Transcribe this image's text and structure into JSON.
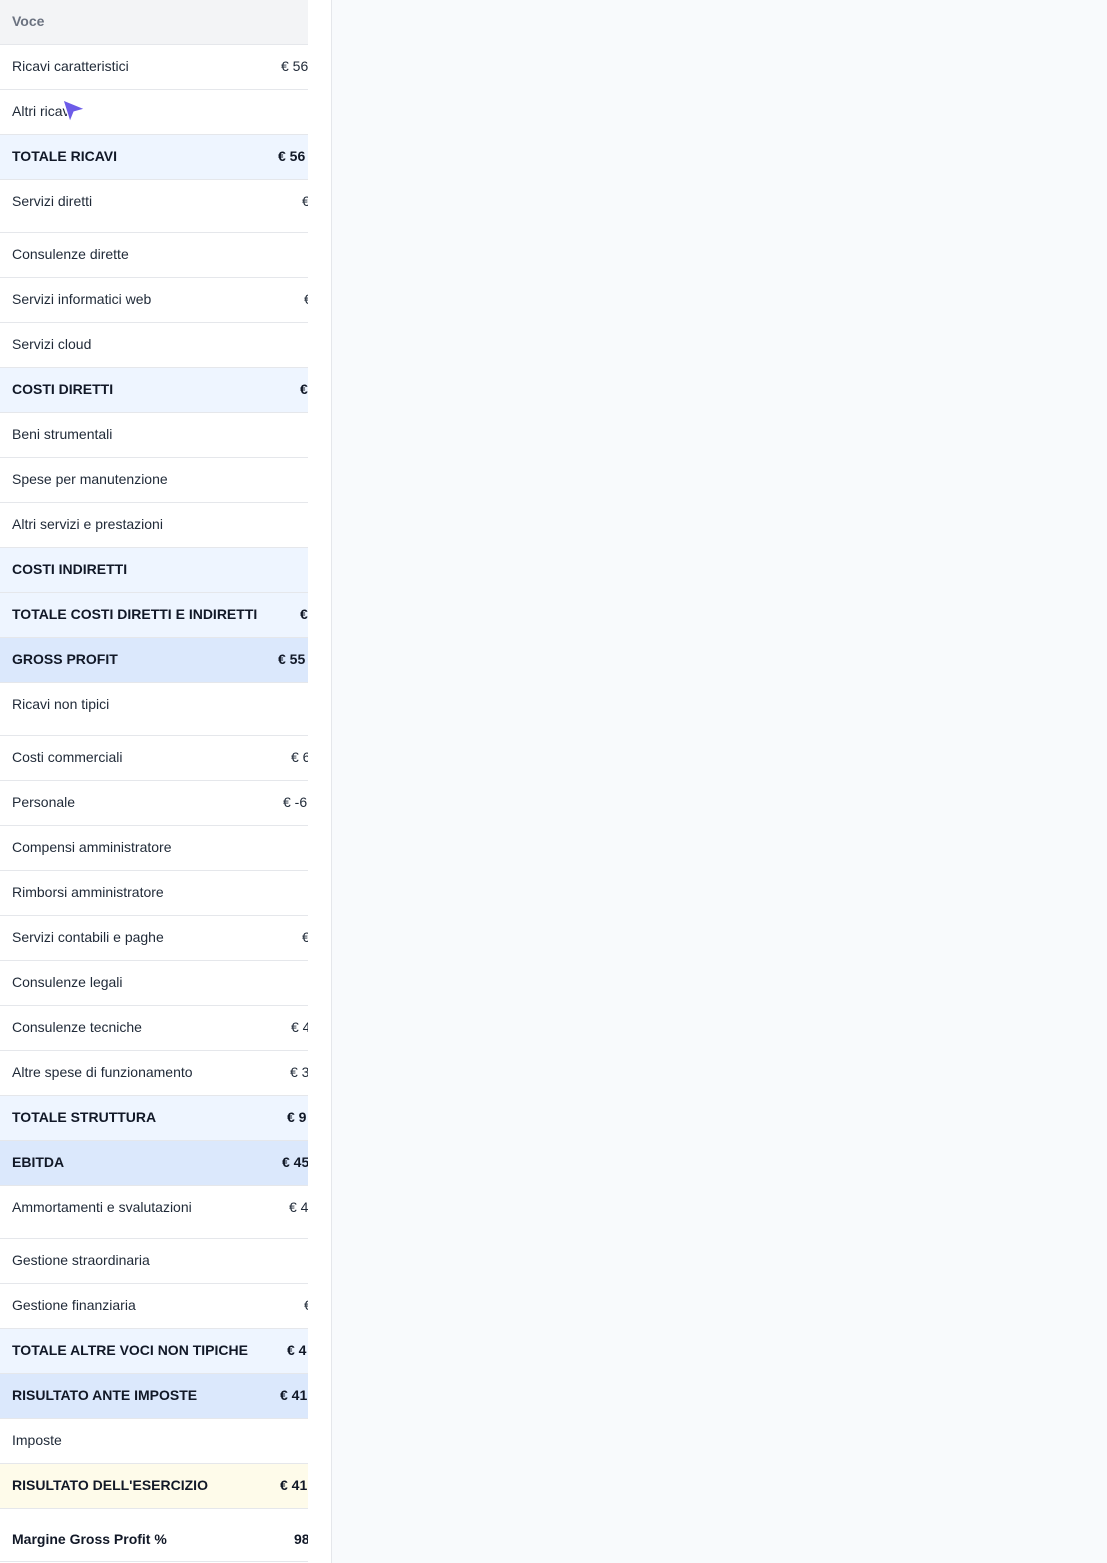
{
  "table": {
    "header": "Voce",
    "rows": [
      {
        "label": "Ricavi caratteristici",
        "value": "€ 56"
      },
      {
        "label": "Altri ricavi",
        "value": ""
      },
      {
        "label": "TOTALE RICAVI",
        "value": "€ 56"
      },
      {
        "label": "Servizi diretti",
        "value": "€"
      },
      {
        "label": "Consulenze dirette",
        "value": ""
      },
      {
        "label": "Servizi informatici web",
        "value": "€"
      },
      {
        "label": "Servizi cloud",
        "value": ""
      },
      {
        "label": "COSTI DIRETTI",
        "value": "€"
      },
      {
        "label": "Beni strumentali",
        "value": ""
      },
      {
        "label": "Spese per manutenzione",
        "value": ""
      },
      {
        "label": "Altri servizi e prestazioni",
        "value": ""
      },
      {
        "label": "COSTI INDIRETTI",
        "value": ""
      },
      {
        "label": "TOTALE COSTI DIRETTI E INDIRETTI",
        "value": "€"
      },
      {
        "label": "GROSS PROFIT",
        "value": "€ 55"
      },
      {
        "label": "Ricavi non tipici",
        "value": ""
      },
      {
        "label": "Costi commerciali",
        "value": "€ 6"
      },
      {
        "label": "Personale",
        "value": "€ -6"
      },
      {
        "label": "Compensi amministratore",
        "value": ""
      },
      {
        "label": "Rimborsi amministratore",
        "value": ""
      },
      {
        "label": "Servizi contabili e paghe",
        "value": "€"
      },
      {
        "label": "Consulenze legali",
        "value": ""
      },
      {
        "label": "Consulenze tecniche",
        "value": "€ 4"
      },
      {
        "label": "Altre spese di funzionamento",
        "value": "€ 3"
      },
      {
        "label": "TOTALE STRUTTURA",
        "value": "€ 9"
      },
      {
        "label": "EBITDA",
        "value": "€ 45"
      },
      {
        "label": "Ammortamenti e svalutazioni",
        "value": "€ 4"
      },
      {
        "label": "Gestione straordinaria",
        "value": ""
      },
      {
        "label": "Gestione finanziaria",
        "value": "€"
      },
      {
        "label": "TOTALE ALTRE VOCI NON TIPICHE",
        "value": "€ 4"
      },
      {
        "label": "RISULTATO ANTE IMPOSTE",
        "value": "€ 41"
      },
      {
        "label": "Imposte",
        "value": ""
      },
      {
        "label": "RISULTATO DELL'ESERCIZIO",
        "value": "€ 41"
      },
      {
        "label": "Margine Gross Profit %",
        "value": "98"
      }
    ]
  },
  "colors": {
    "subtotal_bg": "#eef5ff",
    "total_bg": "#dbe8fc",
    "result_bg": "#fefbea",
    "cursor": "#6d5ce8"
  }
}
